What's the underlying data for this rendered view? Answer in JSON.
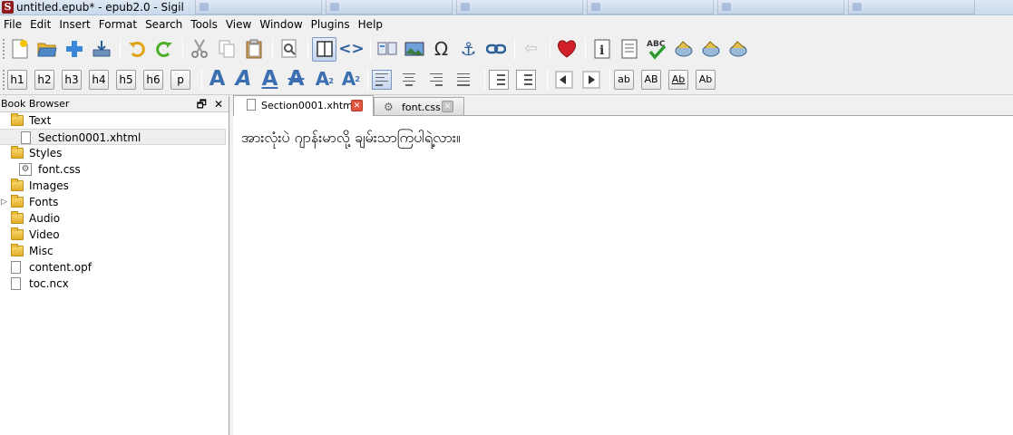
{
  "window": {
    "title": "untitled.epub* - epub2.0 - Sigil",
    "app_icon_letter": "S"
  },
  "menu": [
    "File",
    "Edit",
    "Insert",
    "Format",
    "Search",
    "Tools",
    "View",
    "Window",
    "Plugins",
    "Help"
  ],
  "toolbar": {
    "headings": [
      "h1",
      "h2",
      "h3",
      "h4",
      "h5",
      "h6",
      "p"
    ],
    "case_buttons": [
      "ab",
      "AB",
      "Ab",
      "Ab"
    ]
  },
  "book_browser": {
    "title": "Book Browser",
    "float_glyph": "🗗",
    "close_glyph": "✕",
    "items": [
      {
        "label": "Text",
        "type": "folder"
      },
      {
        "label": "Section0001.xhtml",
        "type": "file",
        "selected": true
      },
      {
        "label": "Styles",
        "type": "folder"
      },
      {
        "label": "font.css",
        "type": "css"
      },
      {
        "label": "Images",
        "type": "folder"
      },
      {
        "label": "Fonts",
        "type": "folder",
        "expandable": true
      },
      {
        "label": "Audio",
        "type": "folder"
      },
      {
        "label": "Video",
        "type": "folder"
      },
      {
        "label": "Misc",
        "type": "folder"
      },
      {
        "label": "content.opf",
        "type": "rootfile"
      },
      {
        "label": "toc.ncx",
        "type": "rootfile"
      }
    ]
  },
  "tabs": [
    {
      "label": "Section0001.xhtml",
      "active": true,
      "close_color": "#e0553f"
    },
    {
      "label": "font.css",
      "active": false,
      "close_color": "#b8b8b8"
    }
  ],
  "editor": {
    "text": "အားလုံးပဲ ဂျာန်းမာလို့ ချမ်းသာကြပါရဲ့လား။"
  },
  "colors": {
    "accent_blue": "#3b6fb0",
    "heart_red": "#d0202a",
    "folder_yellow": "#e2ad27"
  }
}
